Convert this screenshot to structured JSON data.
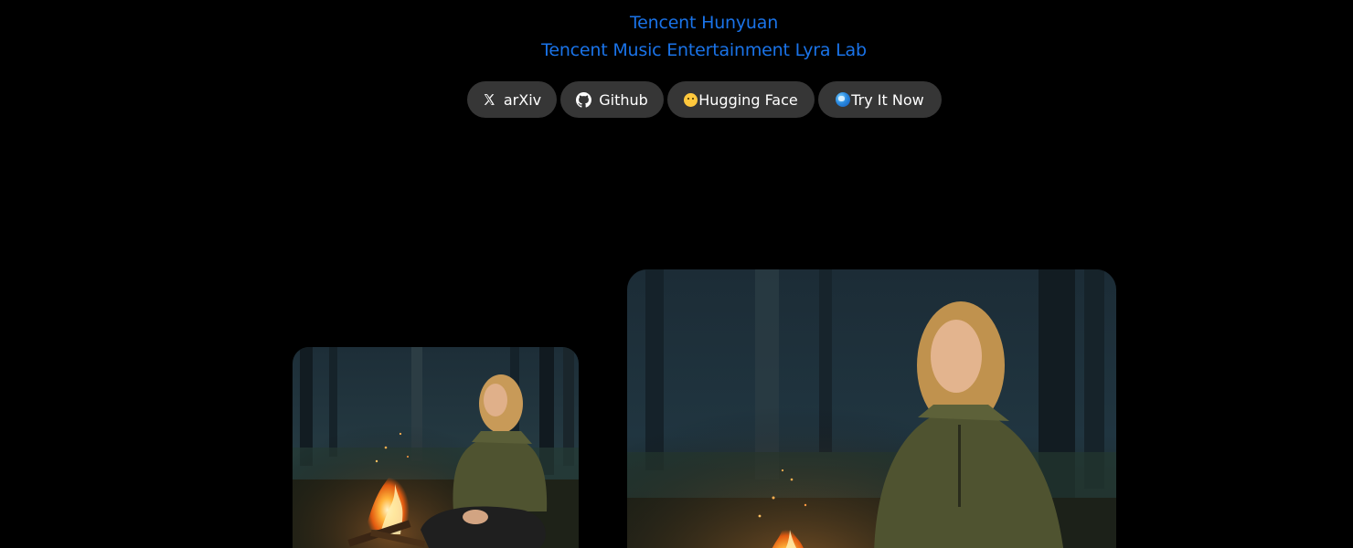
{
  "affiliations": {
    "line1": "Tencent Hunyuan",
    "line2": "Tencent Music Entertainment Lyra Lab"
  },
  "links": {
    "arxiv": {
      "label": "arXiv",
      "icon": "x-logo-icon"
    },
    "github": {
      "label": "Github",
      "icon": "github-icon"
    },
    "huggingface": {
      "label": "Hugging Face",
      "icon": "hugging-face-emoji-icon"
    },
    "try_it_now": {
      "label": "Try It Now",
      "icon": "globe-icon"
    }
  },
  "colors": {
    "background": "#000000",
    "affiliation_text": "#1a73e8",
    "button_bg": "#363636",
    "button_text": "#ffffff"
  },
  "media": {
    "left_image": "campfire-girl-forest-photo",
    "right_video": "campfire-girl-forest-video-frame"
  }
}
